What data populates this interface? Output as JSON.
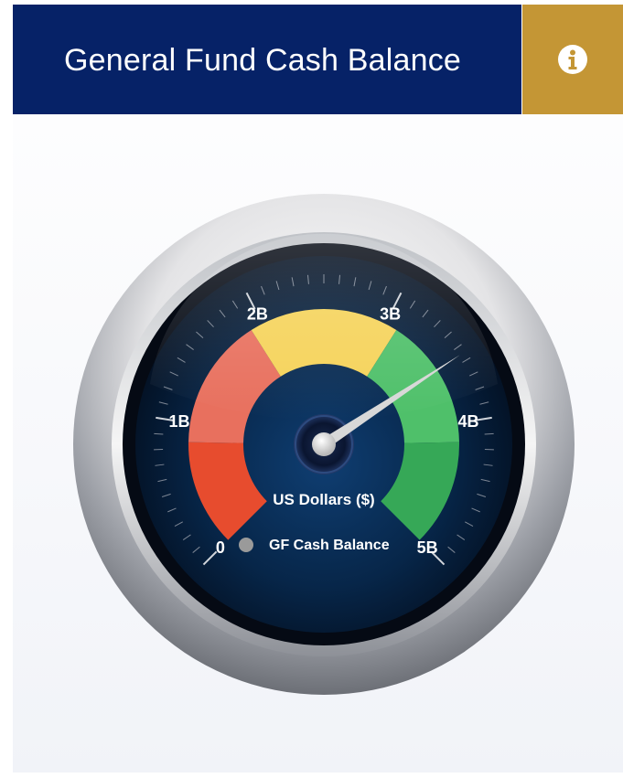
{
  "header": {
    "title": "General Fund Cash Balance",
    "info_icon": "info-circle-icon"
  },
  "colors": {
    "header_bg": "#062267",
    "info_bg": "#c49635",
    "band_red": "#e74c2e",
    "band_salmon": "#e8705e",
    "band_yellow": "#f5d35a",
    "band_lightgreen": "#4fc06a",
    "band_green": "#36a857",
    "needle": "#d8d8d8",
    "legend_marker": "#9a9a9a"
  },
  "chart_data": {
    "type": "gauge",
    "min": 0,
    "max": 5,
    "value": 3.55,
    "unit_label": "US Dollars ($)",
    "tick_labels": [
      "0",
      "1B",
      "2B",
      "3B",
      "4B",
      "5B"
    ],
    "tick_values": [
      0,
      1,
      2,
      3,
      4,
      5
    ],
    "bands": [
      {
        "from": 0,
        "to": 0.85,
        "color": "#e74c2e"
      },
      {
        "from": 0.85,
        "to": 1.9,
        "color": "#e8705e"
      },
      {
        "from": 1.9,
        "to": 3.1,
        "color": "#f5d35a"
      },
      {
        "from": 3.1,
        "to": 4.15,
        "color": "#4fc06a"
      },
      {
        "from": 4.15,
        "to": 5,
        "color": "#36a857"
      }
    ],
    "legend": [
      {
        "name": "GF Cash Balance",
        "color": "#9a9a9a"
      }
    ]
  }
}
